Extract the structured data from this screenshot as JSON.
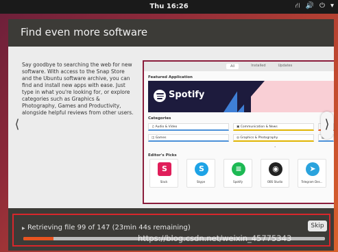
{
  "topbar": {
    "clock": "Thu 16:26",
    "icons": [
      "network-icon",
      "volume-icon",
      "power-icon",
      "chevron-down-icon"
    ]
  },
  "header": {
    "title": "Find even more software"
  },
  "description": "Say goodbye to searching the web for new software. With access to the Snap Store and the Ubuntu software archive, you can find and install new apps with ease. Just type in what you're looking for, or explore categories such as Graphics & Photography, Games and Productivity, alongside helpful reviews from other users.",
  "preview": {
    "tabs": [
      "All",
      "Installed",
      "Updates"
    ],
    "featured_label": "Featured Application",
    "featured_app": "Spotify",
    "categories_label": "Categories",
    "categories": [
      "Audio & Video",
      "Communication & News",
      "Games",
      "Graphics & Photography"
    ],
    "categories_extra": "Ac",
    "more_dot": "•",
    "picks_label": "Editor's Picks",
    "picks": [
      {
        "name": "Slack",
        "glyph": "S",
        "color": "#e01e5a"
      },
      {
        "name": "Skype",
        "glyph": "S",
        "color": "#1ea3e6"
      },
      {
        "name": "Spotify",
        "glyph": "≡",
        "color": "#1db954"
      },
      {
        "name": "OBS Studio",
        "glyph": "◉",
        "color": "#222222"
      },
      {
        "name": "Telegram Des...",
        "glyph": "➤",
        "color": "#2aa3dd"
      }
    ]
  },
  "nav": {
    "prev": "⟨",
    "next": "⟩"
  },
  "status": {
    "text": "Retrieving file 99 of 147 (23min 44s remaining)",
    "skip_label": "Skip",
    "progress_fraction": 0.1
  },
  "watermark": "https://blog.csdn.net/weixin_45775343",
  "colors": {
    "accent": "#e95420",
    "highlight_border": "#d9262b"
  }
}
